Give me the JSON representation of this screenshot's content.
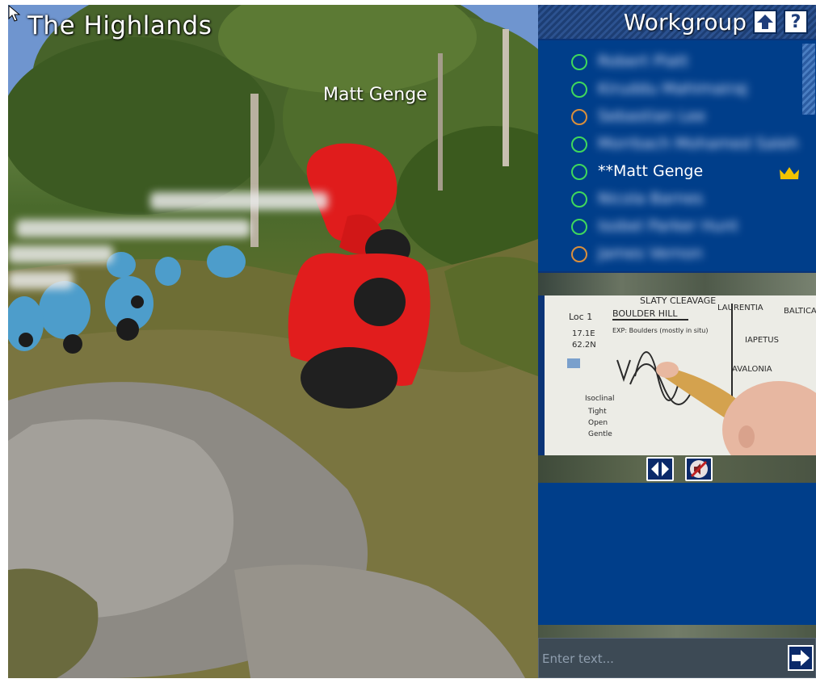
{
  "scene": {
    "world_title": "The Highlands",
    "avatar_nameplate": "Matt Genge",
    "blurred_labels": [
      "Isobel Parker Hunt",
      "Mohamed Khaled Saleh",
      "James Vernon"
    ]
  },
  "workgroup": {
    "title": "Workgroup",
    "up_button_label": "🡅",
    "help_button_label": "?",
    "members": [
      {
        "name": "Robert Platt",
        "status": "online",
        "blurred": true
      },
      {
        "name": "Kiruddu Mahimairaj",
        "status": "online",
        "blurred": true
      },
      {
        "name": "Sebastian Lee",
        "status": "away",
        "blurred": true
      },
      {
        "name": "Morrbach Mohamed Saleh",
        "status": "online",
        "blurred": true
      },
      {
        "name": "**Matt Genge",
        "status": "online",
        "blurred": false,
        "leader": true
      },
      {
        "name": "Nicola Barnes",
        "status": "online",
        "blurred": true
      },
      {
        "name": "Isobel Parker Hunt",
        "status": "online",
        "blurred": true
      },
      {
        "name": "James Vernon",
        "status": "away",
        "blurred": true
      }
    ],
    "colors": {
      "online": "#3fd85c",
      "away": "#d98f3c",
      "panel": "#003e8a",
      "crown": "#f2c300"
    }
  },
  "video": {
    "whiteboard_texts": [
      "SLATY CLEAVAGE",
      "LAURENTIA",
      "BALTICA",
      "Loc 1",
      "BOULDER HILL",
      "17.1E",
      "62.2N",
      "EXP: Boulders (mostly in situ)",
      "IAPETUS",
      "AVALONIA",
      "Isoclinal",
      "Tight",
      "Open",
      "Gentle"
    ],
    "control_icons": [
      "expand-arrows-icon",
      "speaker-muted-icon"
    ]
  },
  "chat": {
    "input_placeholder": "Enter text...",
    "send_icon": "arrow-right-icon"
  }
}
